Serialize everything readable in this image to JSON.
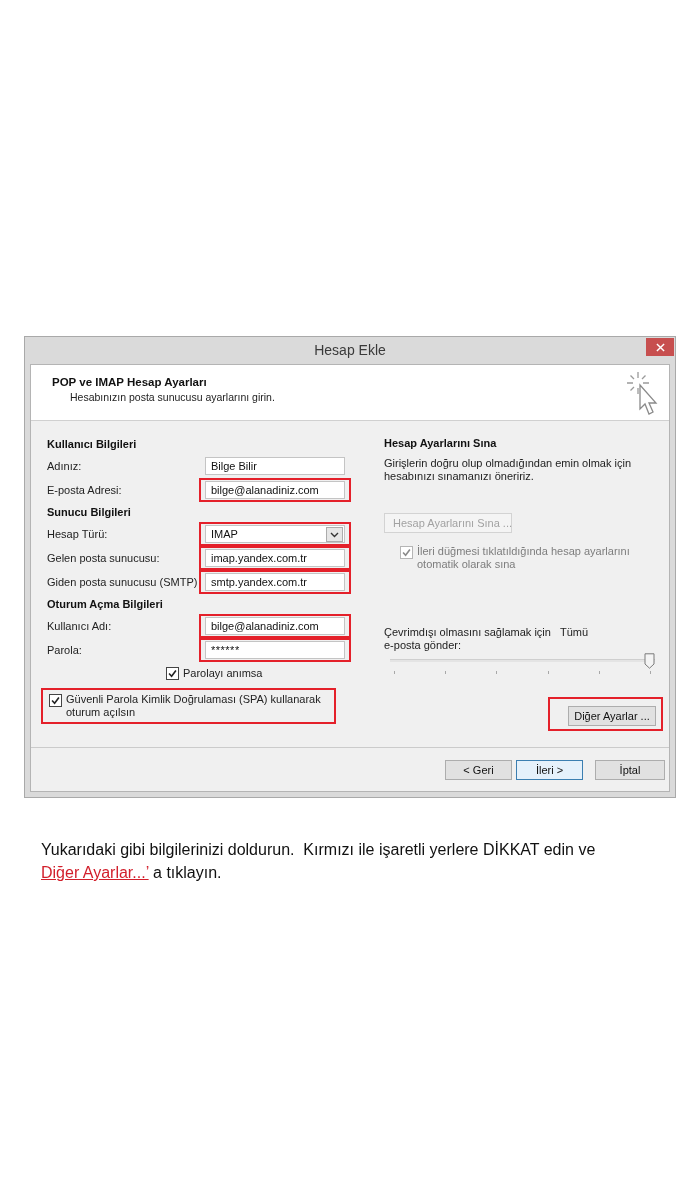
{
  "window": {
    "title": "Hesap Ekle"
  },
  "header": {
    "title": "POP ve IMAP Hesap Ayarları",
    "subtitle": "Hesabınızın posta sunucusu ayarlarını girin."
  },
  "sections": [
    {
      "heading": "Kullanıcı Bilgileri",
      "fields": [
        {
          "kind": "text",
          "label": "Adınız:",
          "value": "Bilge Bilir",
          "highlighted": false
        },
        {
          "kind": "text",
          "label": "E-posta Adresi:",
          "value": "bilge@alanadiniz.com",
          "highlighted": true
        }
      ]
    },
    {
      "heading": "Sunucu Bilgileri",
      "fields": [
        {
          "kind": "dropdown",
          "label": "Hesap Türü:",
          "value": "IMAP",
          "highlighted": true
        },
        {
          "kind": "text",
          "label": "Gelen posta sunucusu:",
          "value": "imap.yandex.com.tr",
          "highlighted": true
        },
        {
          "kind": "text",
          "label": "Giden posta sunucusu (SMTP)",
          "value": "smtp.yandex.com.tr",
          "highlighted": true
        }
      ]
    },
    {
      "heading": "Oturum Açma Bilgileri",
      "fields": [
        {
          "kind": "text",
          "label": "Kullanıcı Adı:",
          "value": "bilge@alanadiniz.com",
          "highlighted": true
        },
        {
          "kind": "password",
          "label": "Parola:",
          "value": "******",
          "highlighted": true
        }
      ]
    }
  ],
  "remember_password": {
    "label": "Parolayı anımsa",
    "checked": true
  },
  "spa": {
    "label": "Güvenli Parola Kimlik Doğrulaması (SPA) kullanarak oturum açılsın",
    "checked": true,
    "highlighted": true
  },
  "test": {
    "heading": "Hesap Ayarlarını Sına",
    "description": "Girişlerin doğru olup olmadığından emin olmak için hesabınızı sınamanızı öneririz.",
    "button": {
      "label": "Hesap Ayarlarını Sına ...",
      "disabled": true
    },
    "auto_test": {
      "label": "İleri düğmesi tıklatıldığında hesap ayarlarını otomatik olarak sına",
      "checked": true,
      "disabled": true
    }
  },
  "offline": {
    "label": "Çevrimdışı olmasını sağlamak için e-posta gönder:",
    "reading": "Tümü",
    "level": 1
  },
  "more_settings": {
    "label": "Diğer Ayarlar ...",
    "highlighted": true
  },
  "buttons": [
    {
      "label": "< Geri",
      "default": false
    },
    {
      "label": "İleri >",
      "default": true
    },
    {
      "label": "İptal",
      "default": false
    }
  ],
  "caption": {
    "text": "Yukarıdaki gibi bilgilerinizi doldurun.  Kırmızı ile işaretli yerlere DİKKAT edin ve",
    "link": "Diğer Ayarlar...’",
    "after": "a tıklayın."
  }
}
